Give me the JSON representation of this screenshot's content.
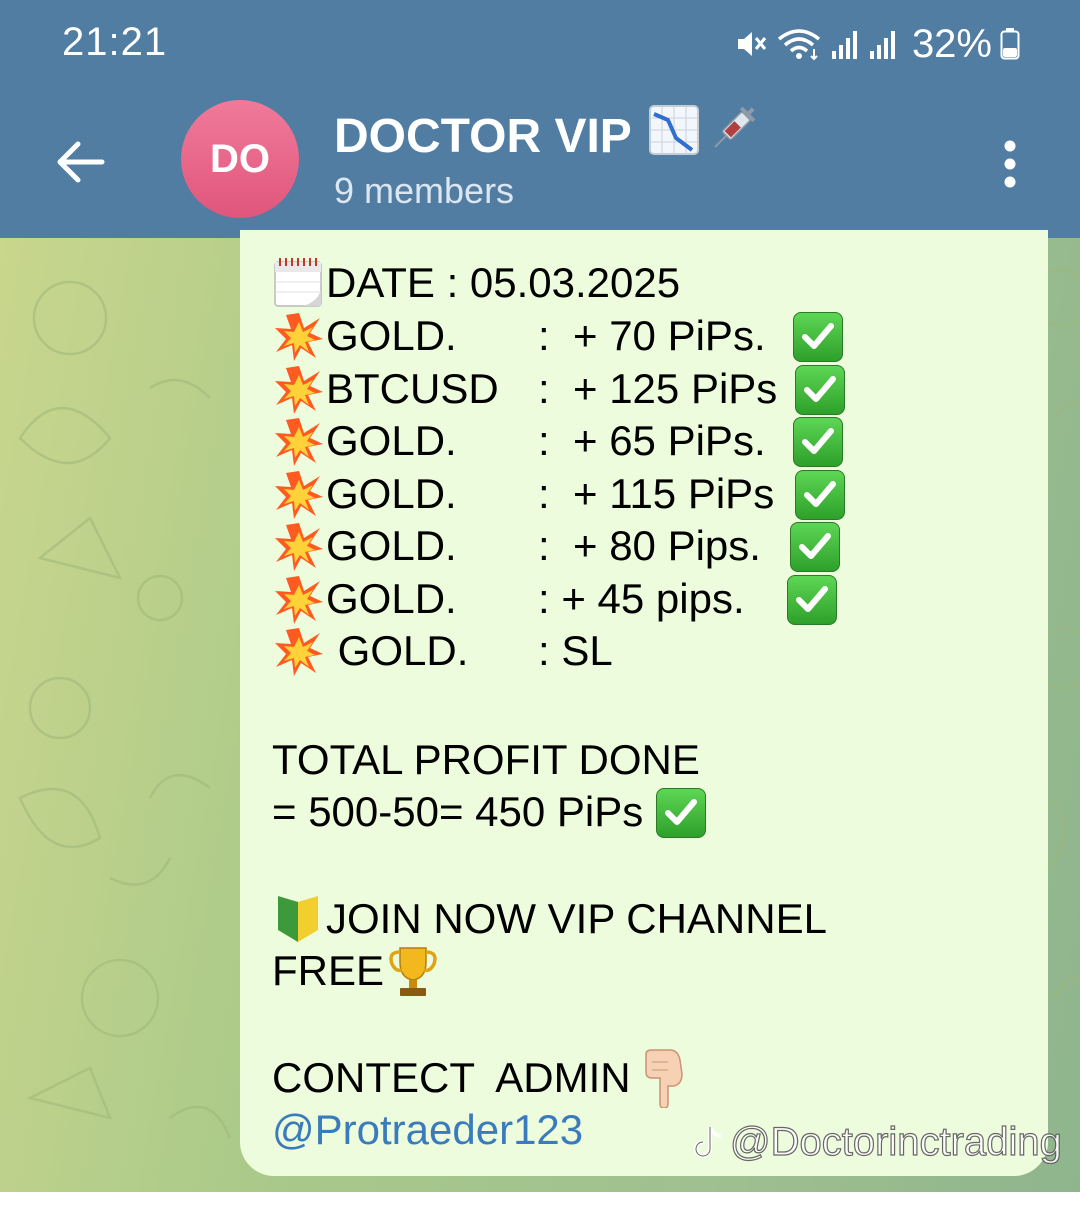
{
  "status_bar": {
    "time": "21:21",
    "battery": "32%",
    "icons": [
      "mute-icon",
      "wifi-icon",
      "signal-icon",
      "signal-icon",
      "battery-icon"
    ]
  },
  "header": {
    "back_icon": "arrow-left-icon",
    "avatar_initials": "DO",
    "title": "DOCTOR VIP",
    "title_emojis": [
      "chart-decreasing-emoji",
      "syringe-emoji"
    ],
    "subtitle": "9 members",
    "menu_icon": "more-vertical-icon",
    "bar_color": "#527da3",
    "avatar_color": "#e8678a"
  },
  "message": {
    "date_line": "DATE : 05.03.2025",
    "results": [
      {
        "symbol": "GOLD.",
        "result": ":  + 70 PiPs.",
        "check": true
      },
      {
        "symbol": "BTCUSD",
        "result": ":  + 125 PiPs",
        "check": true
      },
      {
        "symbol": "GOLD.",
        "result": ":  + 65 PiPs.",
        "check": true
      },
      {
        "symbol": "GOLD.",
        "result": ":  + 115 PiPs",
        "check": true
      },
      {
        "symbol": "GOLD.",
        "result": ":  + 80 Pips.",
        "check": true
      },
      {
        "symbol": "GOLD.",
        "result": ": + 45 pips.",
        "check": true
      },
      {
        "symbol": " GOLD.",
        "result": ": SL",
        "check": false
      }
    ],
    "total_line1": "TOTAL PROFIT DONE",
    "total_line2": "= 500-50= 450 PiPs",
    "join_line1": "JOIN NOW VIP CHANNEL",
    "join_line2": "FREE",
    "contact_line": "CONTECT  ADMIN",
    "admin_handle": "@Protraeder123",
    "bubble_color": "#edfcdc"
  },
  "watermark": "@Doctorinctrading"
}
